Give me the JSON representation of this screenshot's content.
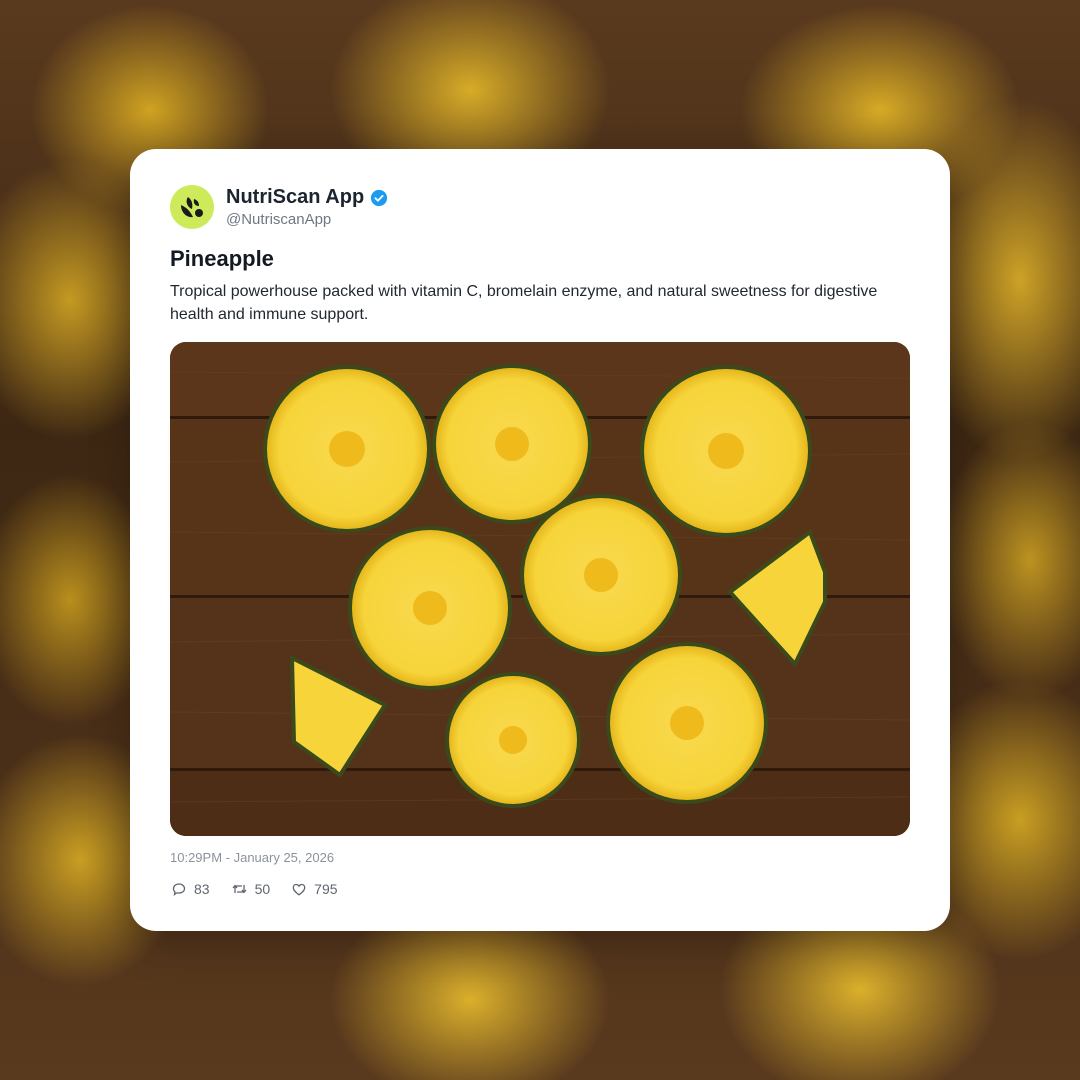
{
  "background": {
    "style": "blurred pineapple slices"
  },
  "post": {
    "author": {
      "display_name": "NutriScan App",
      "handle": "@NutriscanApp",
      "verified": true,
      "avatar_color": "#cdea5a",
      "verified_color": "#1d9bf0"
    },
    "title": "Pineapple",
    "description": "Tropical powerhouse packed with vitamin C, bromelain enzyme, and natural sweetness for digestive health and immune support.",
    "image": {
      "subject": "pineapple slices on wooden table"
    },
    "timestamp": "10:29PM - January 25, 2026",
    "stats": {
      "replies": "83",
      "reposts": "50",
      "likes": "795"
    }
  }
}
